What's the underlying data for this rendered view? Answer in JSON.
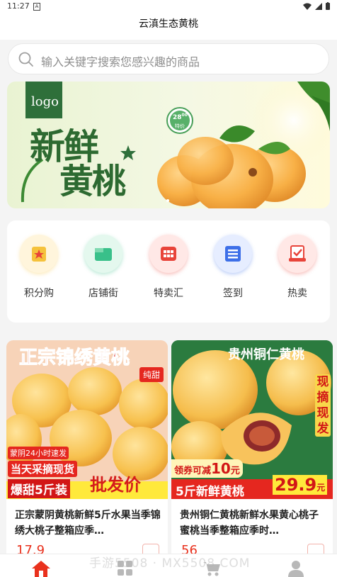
{
  "status_bar": {
    "time": "11:27"
  },
  "header": {
    "title": "云滇生态黄桃"
  },
  "search": {
    "placeholder": "输入关键字搜索您感兴趣的商品"
  },
  "banner": {
    "logo": "logo",
    "badge_price": "28",
    "badge_price_sup": "00",
    "badge_tag": "特价",
    "headline_1": "新鲜",
    "headline_2": "黄桃"
  },
  "menu": {
    "items": [
      {
        "label": "积分购",
        "icon": "points-shop-icon",
        "color": "#f5c23c"
      },
      {
        "label": "店铺街",
        "icon": "store-street-icon",
        "color": "#39c08a"
      },
      {
        "label": "特卖汇",
        "icon": "special-sale-icon",
        "color": "#e8443a"
      },
      {
        "label": "签到",
        "icon": "checkin-icon",
        "color": "#3d6fe8"
      },
      {
        "label": "热卖",
        "icon": "hot-sale-icon",
        "color": "#e8443a"
      }
    ]
  },
  "products": [
    {
      "img_headline": "正宗锦绣黄桃",
      "img_tag": "纯甜",
      "img_red_tag": "蒙阴24小时速发",
      "img_line_1": "当天采摘现货",
      "img_line_2": "爆甜5斤装",
      "img_line_3": "批发价",
      "title": "正宗蒙阴黄桃新鲜5斤水果当季锦绣大桃子整箱应季…",
      "price": "17.9"
    },
    {
      "img_headline": "贵州铜仁黄桃",
      "img_tag": "现摘现发",
      "img_coupon": "领券可减",
      "img_coupon_value": "10",
      "img_coupon_unit": "元",
      "img_line_1": "5斤新鲜黄桃",
      "img_price": "29.9",
      "img_price_unit": "元",
      "title": "贵州铜仁黄桃新鲜水果黄心桃子蜜桃当季整箱应季时…",
      "price": "56"
    }
  ],
  "watermark": "手游5508 · MX5508.COM",
  "colors": {
    "accent": "#e9311d",
    "background": "#f4f4f4"
  }
}
